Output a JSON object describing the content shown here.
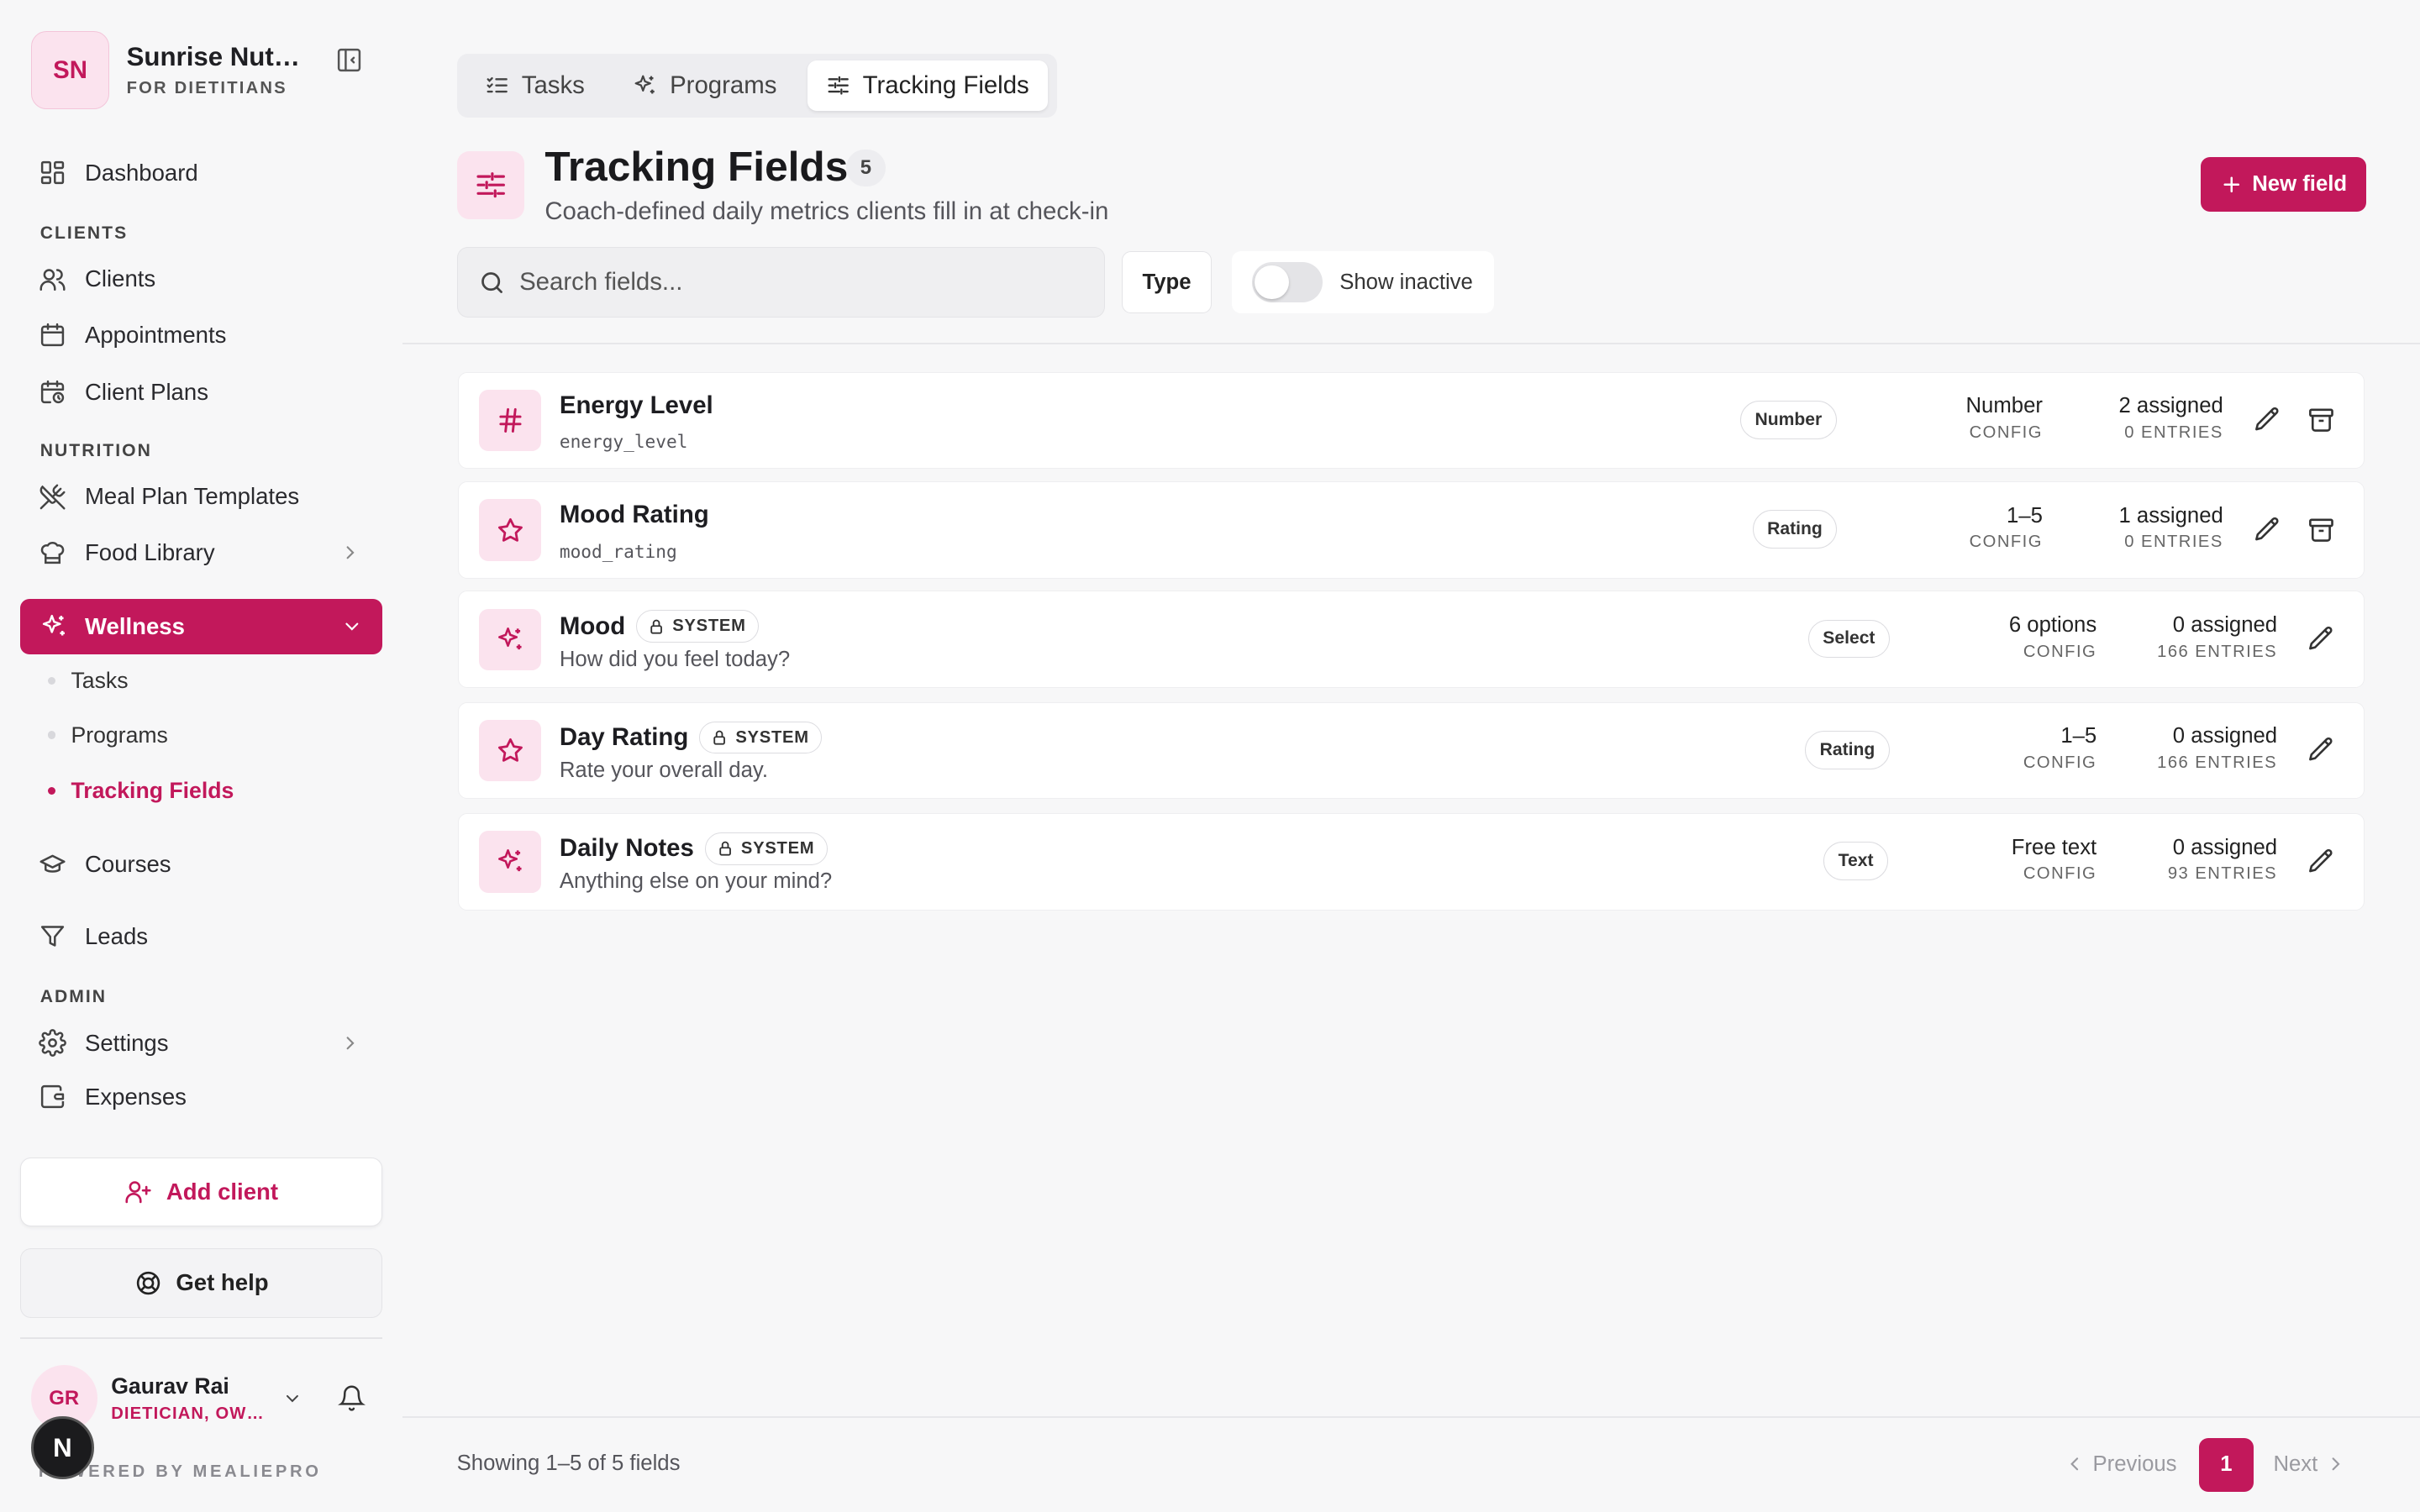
{
  "brand": {
    "initials": "SN",
    "name": "Sunrise Nutrition",
    "subtitle": "FOR DIETITIANS"
  },
  "nav": {
    "dashboard": "Dashboard",
    "section_clients": "CLIENTS",
    "clients": "Clients",
    "appointments": "Appointments",
    "client_plans": "Client Plans",
    "section_nutrition": "NUTRITION",
    "meal_plan_templates": "Meal Plan Templates",
    "food_library": "Food Library",
    "wellness": "Wellness",
    "wellness_sub": [
      "Tasks",
      "Programs",
      "Tracking Fields"
    ],
    "courses": "Courses",
    "leads": "Leads",
    "section_admin": "ADMIN",
    "settings": "Settings",
    "expenses": "Expenses"
  },
  "actions": {
    "add_client": "Add client",
    "get_help": "Get help"
  },
  "user": {
    "initials": "GR",
    "name": "Gaurav Rai",
    "role": "DIETICIAN, OWNER"
  },
  "powered_by": "POWERED BY MEALIEPRO",
  "n_badge": "N",
  "tabs": [
    {
      "label": "Tasks"
    },
    {
      "label": "Programs"
    },
    {
      "label": "Tracking Fields"
    }
  ],
  "page": {
    "title": "Tracking Fields",
    "count": "5",
    "subtitle": "Coach-defined daily metrics clients fill in at check-in",
    "new_button": "New field"
  },
  "filters": {
    "search_placeholder": "Search fields...",
    "type_button": "Type",
    "show_inactive": "Show inactive"
  },
  "fields": [
    {
      "name": "Energy Level",
      "sub": "energy_level",
      "system": "",
      "type": "Number",
      "config": "Number",
      "config_label": "CONFIG",
      "assigned": "2 assigned",
      "entries": "0 ENTRIES",
      "icon": "hash-icon"
    },
    {
      "name": "Mood Rating",
      "sub": "mood_rating",
      "system": "",
      "type": "Rating",
      "config": "1–5",
      "config_label": "CONFIG",
      "assigned": "1 assigned",
      "entries": "0 ENTRIES",
      "icon": "star-icon"
    },
    {
      "name": "Mood",
      "sub": "How did you feel today?",
      "system": "SYSTEM",
      "type": "Select",
      "config": "6 options",
      "config_label": "CONFIG",
      "assigned": "0 assigned",
      "entries": "166 ENTRIES",
      "icon": "sparkle-icon"
    },
    {
      "name": "Day Rating",
      "sub": "Rate your overall day.",
      "system": "SYSTEM",
      "type": "Rating",
      "config": "1–5",
      "config_label": "CONFIG",
      "assigned": "0 assigned",
      "entries": "166 ENTRIES",
      "icon": "star-icon"
    },
    {
      "name": "Daily Notes",
      "sub": "Anything else on your mind?",
      "system": "SYSTEM",
      "type": "Text",
      "config": "Free text",
      "config_label": "CONFIG",
      "assigned": "0 assigned",
      "entries": "93 ENTRIES",
      "icon": "sparkle-icon"
    }
  ],
  "pagination": {
    "showing": "Showing 1–5 of 5 fields",
    "previous": "Previous",
    "current": "1",
    "next": "Next"
  },
  "colors": {
    "accent": "#c2185b",
    "accent_soft": "#fbe3ee"
  }
}
